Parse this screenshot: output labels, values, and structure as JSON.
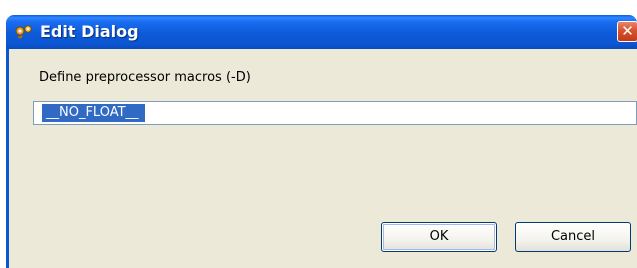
{
  "dialog": {
    "title": "Edit Dialog",
    "title_icon": "ideas-icon",
    "close_icon": "close-icon",
    "close_glyph": "✕",
    "field_label": "Define preprocessor macros (-D)",
    "macro_value": "__NO_FLOAT__",
    "ok_label": "OK",
    "cancel_label": "Cancel"
  },
  "colors": {
    "titlebar": "#0c56d2",
    "close_button": "#d4542e",
    "dialog_body": "#ece9d8",
    "selection": "#316ac5",
    "input_border": "#7f9db9"
  }
}
